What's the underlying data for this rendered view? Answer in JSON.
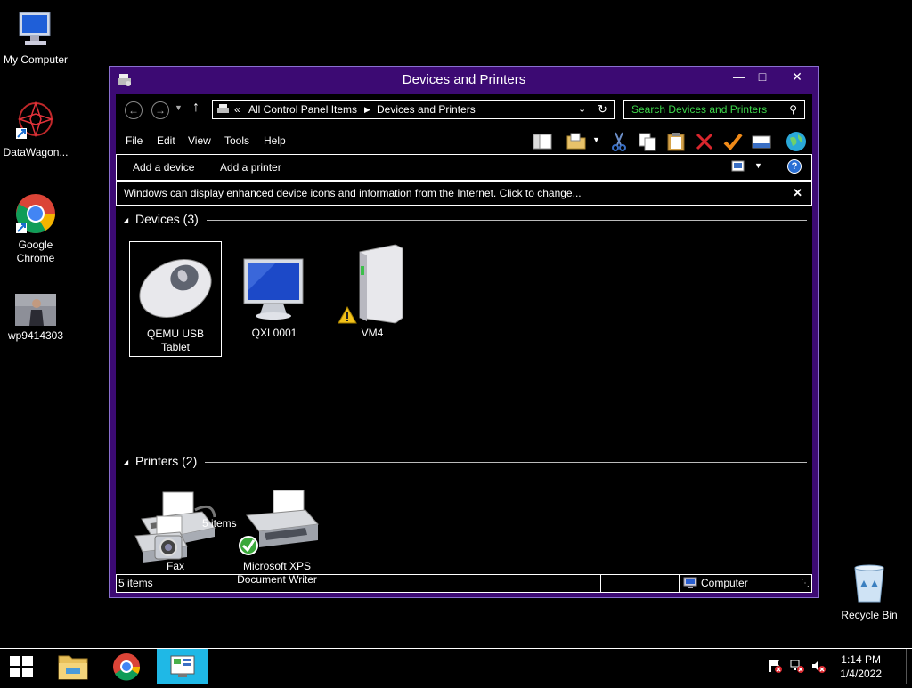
{
  "desktop": {
    "icons": [
      {
        "label": "My Computer",
        "icon": "computer-icon"
      },
      {
        "label": "DataWagon...",
        "icon": "datawagon-icon"
      },
      {
        "label": "Google Chrome",
        "icon": "chrome-icon"
      },
      {
        "label": "wp9414303",
        "icon": "image-file-icon"
      },
      {
        "label": "Recycle Bin",
        "icon": "recycle-bin-icon"
      }
    ]
  },
  "window": {
    "title": "Devices and Printers",
    "address": {
      "chevron": "«",
      "crumbs": [
        "All Control Panel Items",
        "Devices and Printers"
      ]
    },
    "search_placeholder": "Search Devices and Printers",
    "menu": [
      "File",
      "Edit",
      "View",
      "Tools",
      "Help"
    ],
    "commands": {
      "add_device": "Add a device",
      "add_printer": "Add a printer"
    },
    "info_bar": "Windows can display enhanced device icons and information from the Internet. Click to change...",
    "groups": {
      "devices": {
        "title": "Devices (3)",
        "items": [
          "QEMU USB Tablet",
          "QXL0001",
          "VM4"
        ]
      },
      "printers": {
        "title": "Printers (2)",
        "items": [
          "Fax",
          "Microsoft XPS Document Writer"
        ]
      }
    },
    "details_text": "5 items",
    "status": {
      "left": "5 items",
      "right": "Computer"
    }
  },
  "taskbar": {
    "time": "1:14 PM",
    "date": "1/4/2022"
  },
  "colors": {
    "titlebar": "#3c0a73",
    "search_text": "#3dd64a",
    "accent_taskbar": "#1fb8e6"
  }
}
